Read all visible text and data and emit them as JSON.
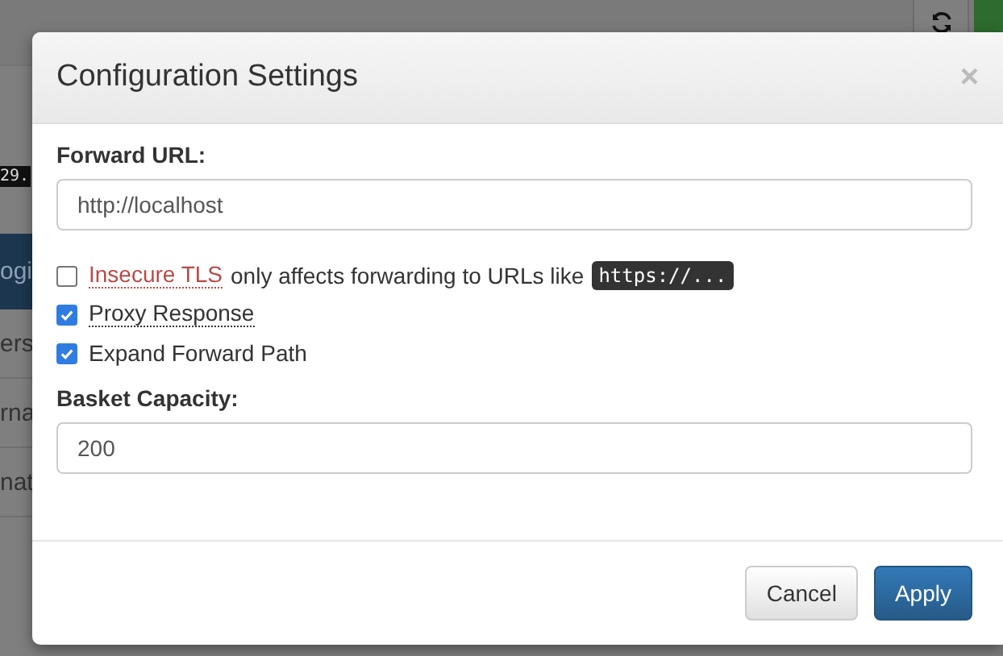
{
  "background_page": {
    "code_chip": "29.",
    "nav_item": "ogi",
    "rows": [
      "ers",
      "rna",
      "nat"
    ]
  },
  "dialog": {
    "title": "Configuration Settings",
    "close": "×",
    "items": [
      {
        "kind": "text",
        "label": "Forward URL:",
        "value": "http://localhost"
      },
      {
        "kind": "checkbox",
        "label": "Insecure TLS",
        "checked": false,
        "tooltip": true,
        "warning": true,
        "note": "only affects forwarding to URLs like",
        "code": "https://..."
      },
      {
        "kind": "checkbox",
        "label": "Proxy Response",
        "checked": true,
        "tooltip": true,
        "warning": false
      },
      {
        "kind": "checkbox",
        "label": "Expand Forward Path",
        "checked": true,
        "tooltip": false,
        "warning": false
      },
      {
        "kind": "text",
        "label": "Basket Capacity:",
        "value": "200"
      }
    ],
    "buttons": [
      {
        "label": "Cancel",
        "kind": "default"
      },
      {
        "label": "Apply",
        "kind": "primary"
      }
    ]
  }
}
